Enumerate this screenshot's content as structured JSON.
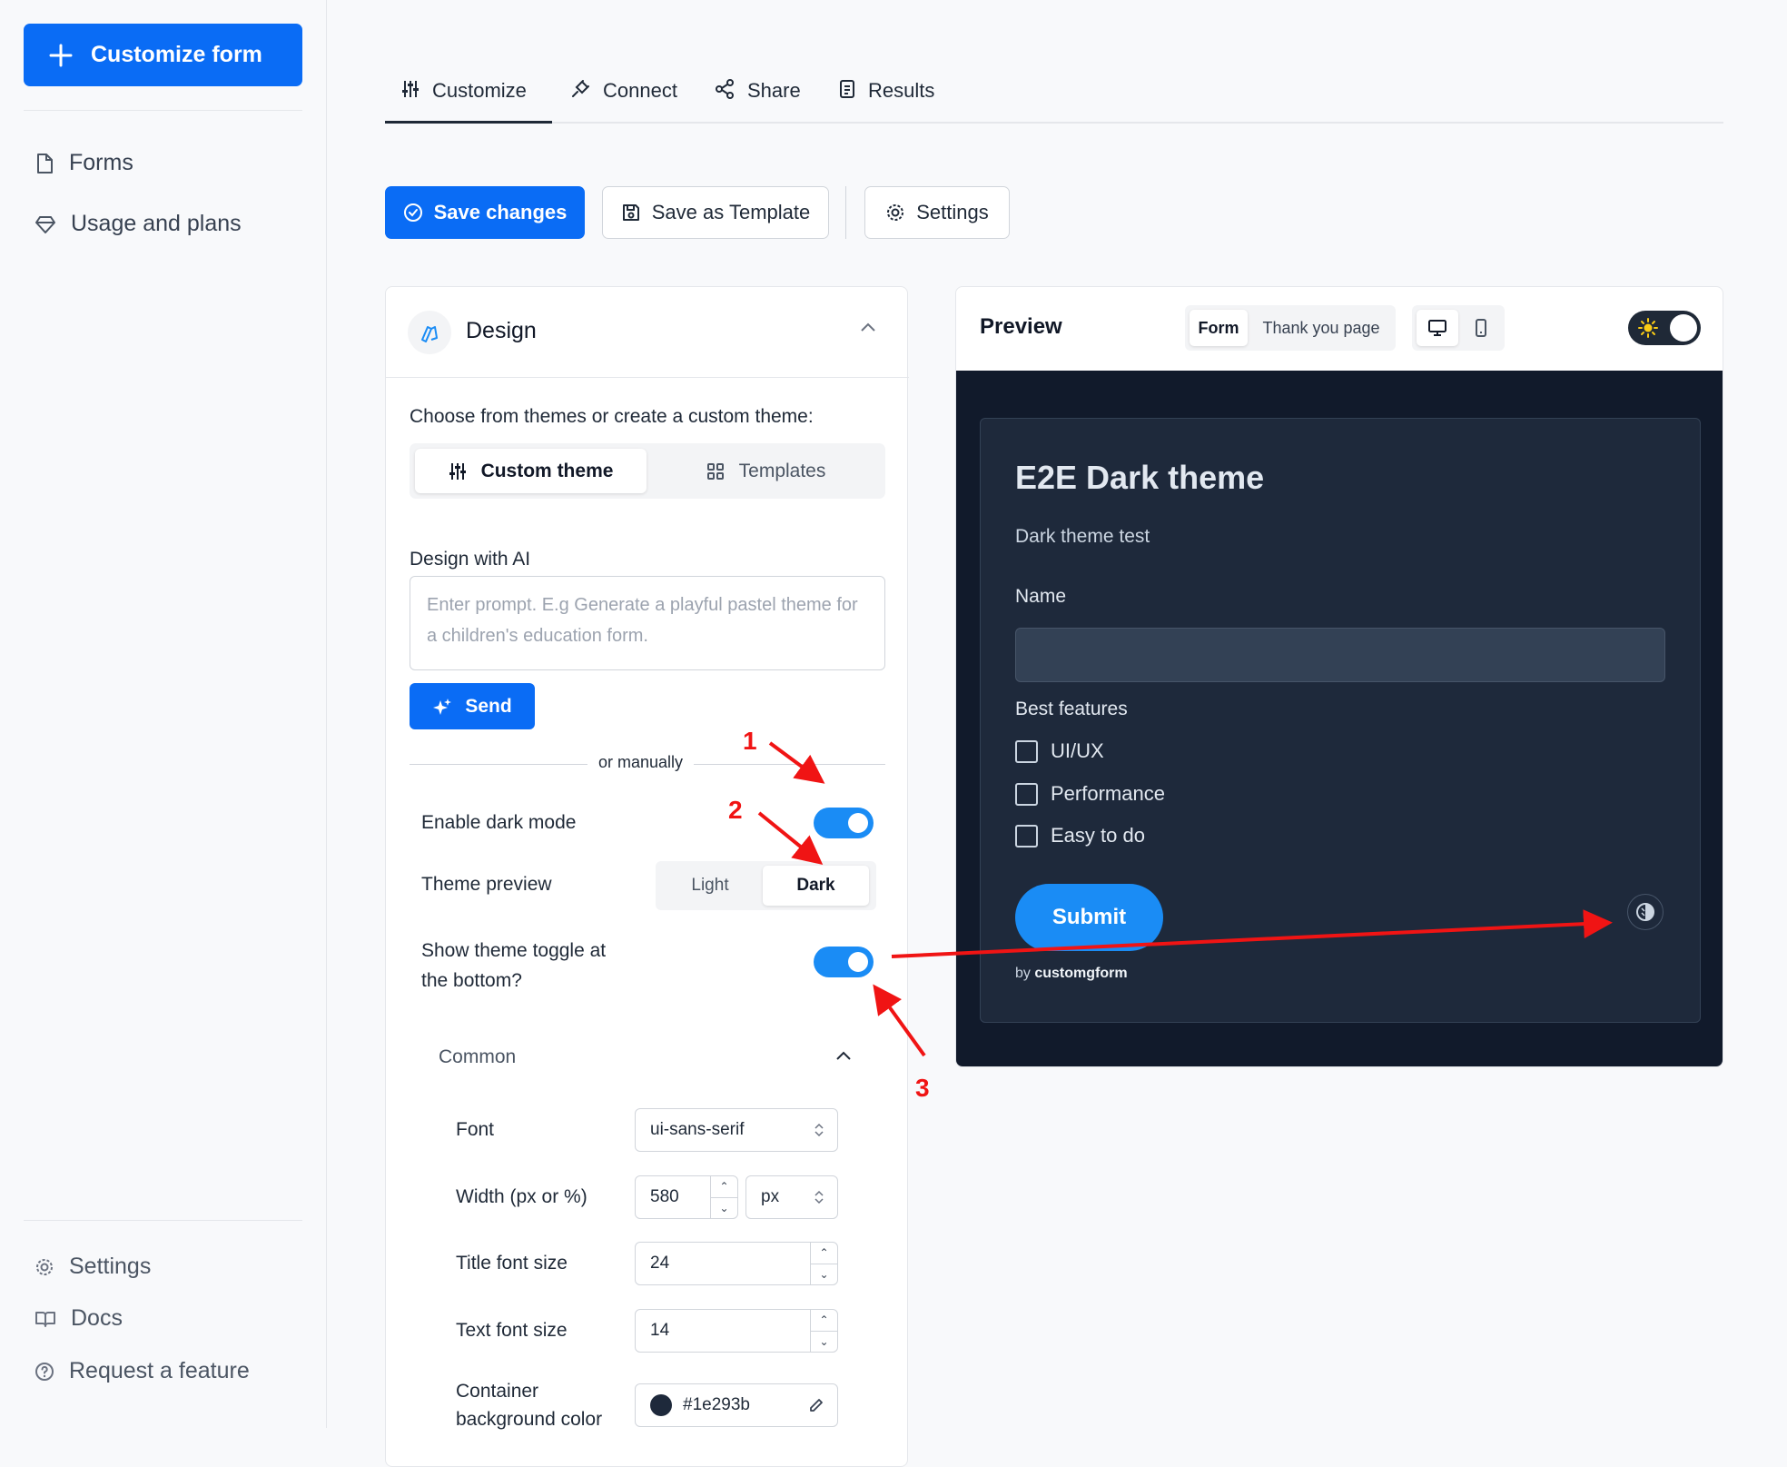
{
  "sidebar": {
    "primary_button": "Customize form",
    "items": [
      {
        "label": "Forms",
        "icon": "file-icon"
      },
      {
        "label": "Usage and plans",
        "icon": "diamond-icon"
      }
    ],
    "bottom_items": [
      {
        "label": "Settings",
        "icon": "gear-icon"
      },
      {
        "label": "Docs",
        "icon": "book-icon"
      },
      {
        "label": "Request a feature",
        "icon": "help-circle-icon"
      }
    ]
  },
  "tabs": [
    {
      "label": "Customize",
      "active": true
    },
    {
      "label": "Connect",
      "active": false
    },
    {
      "label": "Share",
      "active": false
    },
    {
      "label": "Results",
      "active": false
    }
  ],
  "toolbar": {
    "save": "Save changes",
    "save_template": "Save as Template",
    "settings": "Settings"
  },
  "design": {
    "title": "Design",
    "choose_text": "Choose from themes or create a custom theme:",
    "segments": [
      "Custom theme",
      "Templates"
    ],
    "ai_label": "Design with AI",
    "ai_placeholder": "Enter prompt. E.g Generate a playful pastel theme for a children's education form.",
    "send": "Send",
    "or_manually": "or manually",
    "dark_mode_label": "Enable dark mode",
    "dark_mode_on": true,
    "theme_preview_label": "Theme preview",
    "theme_preview_options": [
      "Light",
      "Dark"
    ],
    "theme_preview_selected": "Dark",
    "toggle_bottom_label": "Show theme toggle at the bottom?",
    "toggle_bottom_on": true,
    "common": {
      "title": "Common",
      "font_label": "Font",
      "font_value": "ui-sans-serif",
      "width_label": "Width (px or %)",
      "width_value": "580",
      "width_unit": "px",
      "title_size_label": "Title font size",
      "title_size_value": "24",
      "text_size_label": "Text font size",
      "text_size_value": "14",
      "container_bg_label": "Container background color",
      "container_bg_value": "#1e293b"
    }
  },
  "preview": {
    "title": "Preview",
    "segments": [
      "Form",
      "Thank you page"
    ],
    "form": {
      "title": "E2E Dark theme",
      "subtitle": "Dark theme test",
      "name_label": "Name",
      "features_label": "Best features",
      "options": [
        "UI/UX",
        "Performance",
        "Easy to do"
      ],
      "submit": "Submit",
      "by": "by",
      "brand": "customgform"
    }
  },
  "annotations": [
    "1",
    "2",
    "3"
  ],
  "colors": {
    "accent": "#0a6cf5",
    "toggle": "#1a8cf5",
    "dark_bg": "#111a2b",
    "card_bg": "#1e293b",
    "annotation": "#f01414"
  }
}
